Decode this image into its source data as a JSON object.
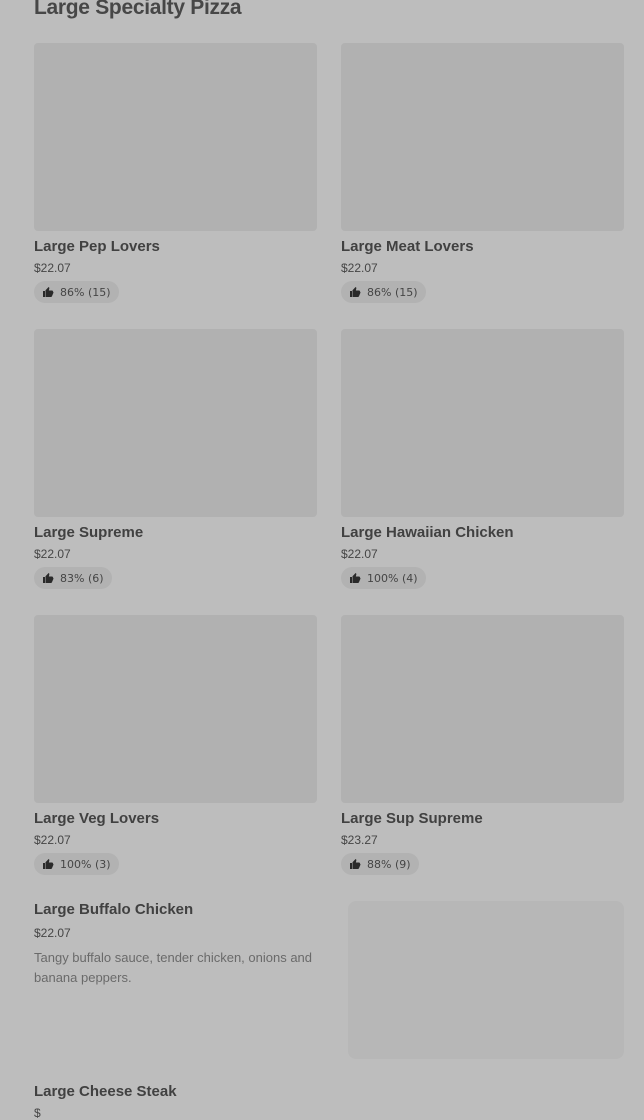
{
  "section": {
    "title": "Large Specialty Pizza"
  },
  "grid_items": [
    {
      "name": "Large Pep Lovers",
      "price": "$22.07",
      "rating": "86% (15)"
    },
    {
      "name": "Large Meat Lovers",
      "price": "$22.07",
      "rating": "86% (15)"
    },
    {
      "name": "Large Supreme",
      "price": "$22.07",
      "rating": "83% (6)"
    },
    {
      "name": "Large Hawaiian Chicken",
      "price": "$22.07",
      "rating": "100% (4)"
    },
    {
      "name": "Large Veg Lovers",
      "price": "$22.07",
      "rating": "100% (3)"
    },
    {
      "name": "Large Sup Supreme",
      "price": "$23.27",
      "rating": "88% (9)"
    }
  ],
  "list_items": [
    {
      "name": "Large Buffalo Chicken",
      "price": "$22.07",
      "description": "Tangy buffalo sauce, tender chicken, onions and banana peppers."
    },
    {
      "name": "Large Cheese Steak",
      "price": "$"
    }
  ],
  "icons": {
    "rating": "thumbs-up-icon"
  }
}
